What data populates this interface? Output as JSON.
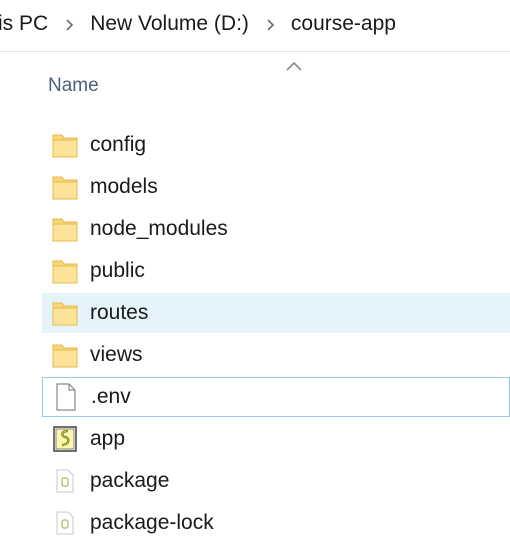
{
  "breadcrumb": {
    "items": [
      {
        "label": "is PC"
      },
      {
        "label": "New Volume (D:)"
      },
      {
        "label": "course-app"
      }
    ]
  },
  "columns": {
    "name": "Name"
  },
  "files": [
    {
      "name": "config",
      "type": "folder"
    },
    {
      "name": "models",
      "type": "folder"
    },
    {
      "name": "node_modules",
      "type": "folder"
    },
    {
      "name": "public",
      "type": "folder"
    },
    {
      "name": "routes",
      "type": "folder",
      "state": "hover"
    },
    {
      "name": "views",
      "type": "folder"
    },
    {
      "name": ".env",
      "type": "file",
      "state": "focus"
    },
    {
      "name": "app",
      "type": "js-script"
    },
    {
      "name": "package",
      "type": "json"
    },
    {
      "name": "package-lock",
      "type": "json"
    }
  ],
  "colors": {
    "folder_fill": "#f8d775",
    "folder_edge": "#e8b84a",
    "hover_bg": "#e5f3fb",
    "focus_border": "#99c9ef",
    "header_text": "#4c607a"
  }
}
